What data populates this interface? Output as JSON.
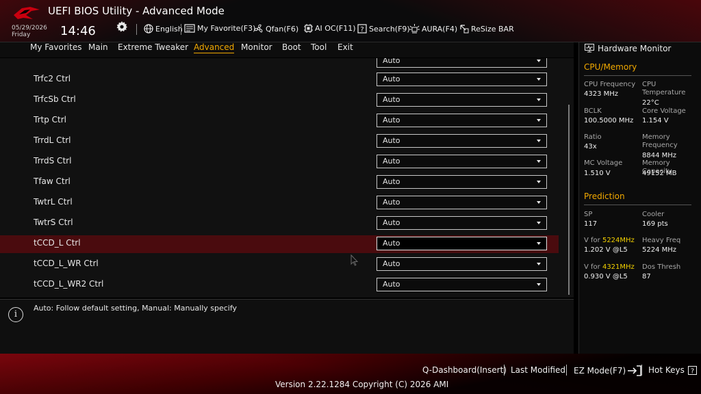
{
  "header": {
    "title": "UEFI BIOS Utility - Advanced Mode",
    "date": "05/29/2026",
    "day": "Friday",
    "time": "14:46",
    "tools": [
      {
        "label": "English",
        "icon": "globe-icon"
      },
      {
        "label": "My Favorite(F3)",
        "icon": "favorite-icon"
      },
      {
        "label": "Qfan(F6)",
        "icon": "fan-icon"
      },
      {
        "label": "AI OC(F11)",
        "icon": "ai-oc-icon"
      },
      {
        "label": "Search(F9)",
        "icon": "search-icon"
      },
      {
        "label": "AURA(F4)",
        "icon": "aura-icon"
      },
      {
        "label": "ReSize BAR",
        "icon": "resize-bar-icon"
      }
    ]
  },
  "menu": {
    "items": [
      "My Favorites",
      "Main",
      "Extreme Tweaker",
      "Advanced",
      "Monitor",
      "Boot",
      "Tool",
      "Exit"
    ],
    "active": "Advanced"
  },
  "settings": {
    "partial_value": "Auto",
    "rows": [
      {
        "label": "Trfc2 Ctrl",
        "value": "Auto"
      },
      {
        "label": "TrfcSb Ctrl",
        "value": "Auto"
      },
      {
        "label": "Trtp Ctrl",
        "value": "Auto"
      },
      {
        "label": "TrrdL Ctrl",
        "value": "Auto"
      },
      {
        "label": "TrrdS Ctrl",
        "value": "Auto"
      },
      {
        "label": "Tfaw Ctrl",
        "value": "Auto"
      },
      {
        "label": "TwtrL Ctrl",
        "value": "Auto"
      },
      {
        "label": "TwtrS Ctrl",
        "value": "Auto"
      },
      {
        "label": "tCCD_L Ctrl",
        "value": "Auto"
      },
      {
        "label": "tCCD_L_WR Ctrl",
        "value": "Auto"
      },
      {
        "label": "tCCD_L_WR2 Ctrl",
        "value": "Auto"
      }
    ],
    "selected_index": 8
  },
  "help": {
    "text": "Auto: Follow default setting, Manual: Manually specify"
  },
  "hardware_monitor": {
    "title": "Hardware Monitor",
    "cpu_memory": {
      "heading": "CPU/Memory",
      "cpu_frequency_label": "CPU Frequency",
      "cpu_frequency": "4323 MHz",
      "cpu_temperature_label_1": "CPU",
      "cpu_temperature_label_2": "Temperature",
      "cpu_temperature": "22°C",
      "bclk_label": "BCLK",
      "bclk": "100.5000 MHz",
      "core_voltage_label": "Core Voltage",
      "core_voltage": "1.154 V",
      "ratio_label": "Ratio",
      "ratio": "43x",
      "memory_frequency_label_1": "Memory",
      "memory_frequency_label_2": "Frequency",
      "memory_frequency": "8844 MHz",
      "mc_voltage_label": "MC Voltage",
      "mc_voltage": "1.510 V",
      "memory_capacity_label": "Memory Capacity",
      "memory_capacity": "49152 MB"
    },
    "prediction": {
      "heading": "Prediction",
      "sp_label": "SP",
      "sp": "117",
      "cooler_label": "Cooler",
      "cooler": "169 pts",
      "v_for_1_prefix": "V for ",
      "v_for_1_freq": "5224MHz",
      "v_for_1": "1.202 V @L5",
      "heavy_freq_label": "Heavy Freq",
      "heavy_freq": "5224 MHz",
      "v_for_2_prefix": "V for ",
      "v_for_2_freq": "4321MHz",
      "v_for_2": "0.930 V @L5",
      "dos_thresh_label": "Dos Thresh",
      "dos_thresh": "87"
    }
  },
  "footer": {
    "qdashboard": "Q-Dashboard(Insert)",
    "last_modified": "Last Modified",
    "ez_mode": "EZ Mode(F7)",
    "hot_keys": "Hot Keys",
    "version": "Version 2.22.1284 Copyright (C) 2026 AMI"
  },
  "colors": {
    "accent": "#f2a900",
    "selected_row": "#4a0b0e",
    "highlight_freq": "#f2d000"
  }
}
